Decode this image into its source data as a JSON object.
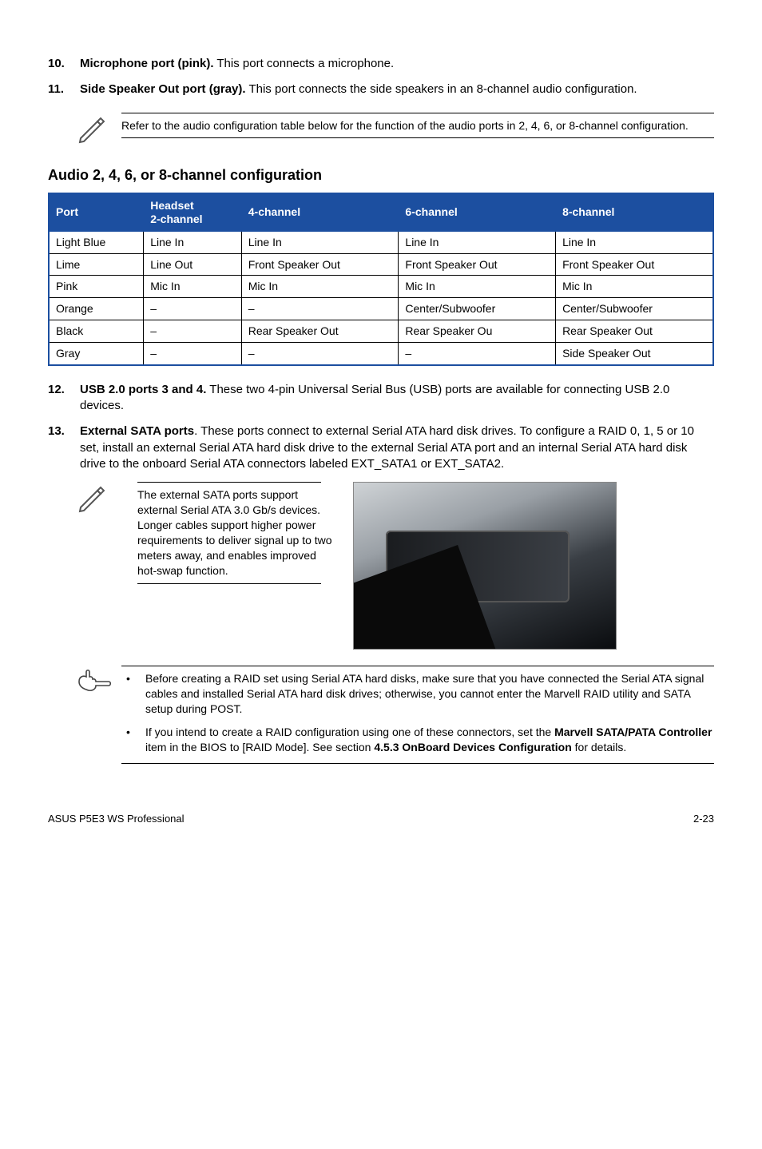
{
  "items": {
    "i10": {
      "num": "10.",
      "lead": "Microphone port (pink).",
      "rest": " This port connects a microphone."
    },
    "i11": {
      "num": "11.",
      "lead": "Side Speaker Out port (gray).",
      "rest": " This port connects the side speakers in an 8-channel audio configuration."
    },
    "i12": {
      "num": "12.",
      "lead": "USB 2.0 ports 3 and 4.",
      "rest": " These two 4-pin Universal Serial Bus (USB) ports are available for connecting USB 2.0 devices."
    },
    "i13": {
      "num": "13.",
      "lead": "External SATA ports",
      "rest": ". These ports connect to external Serial ATA hard disk drives. To configure a RAID 0, 1, 5 or 10 set, install an external Serial ATA hard disk drive to the external Serial ATA port and an internal Serial ATA hard disk drive to the onboard Serial ATA connectors labeled EXT_SATA1 or EXT_SATA2."
    }
  },
  "note1": "Refer to the audio configuration table below for the function of the audio ports in 2, 4, 6, or 8-channel configuration.",
  "section_heading": "Audio 2, 4, 6, or 8-channel configuration",
  "table": {
    "headers": {
      "c1": "Port",
      "c2_l1": "Headset",
      "c2_l2": "2-channel",
      "c3": "4-channel",
      "c4": "6-channel",
      "c5": "8-channel"
    },
    "rows": [
      {
        "c1": "Light Blue",
        "c2": "Line In",
        "c3": "Line In",
        "c4": "Line In",
        "c5": "Line In"
      },
      {
        "c1": "Lime",
        "c2": "Line Out",
        "c3": "Front Speaker Out",
        "c4": "Front Speaker Out",
        "c5": "Front Speaker Out"
      },
      {
        "c1": "Pink",
        "c2": "Mic In",
        "c3": "Mic In",
        "c4": "Mic In",
        "c5": "Mic In"
      },
      {
        "c1": "Orange",
        "c2": "–",
        "c3": "–",
        "c4": "Center/Subwoofer",
        "c5": "Center/Subwoofer"
      },
      {
        "c1": "Black",
        "c2": "–",
        "c3": "Rear Speaker Out",
        "c4": "Rear Speaker Ou",
        "c5": "Rear Speaker Out"
      },
      {
        "c1": "Gray",
        "c2": "–",
        "c3": "–",
        "c4": "–",
        "c5": "Side Speaker Out"
      }
    ]
  },
  "note2": "The external SATA ports support external Serial ATA 3.0 Gb/s devices. Longer cables support higher power requirements to deliver signal up to two meters away, and enables improved hot-swap function.",
  "bullets": {
    "b1": "Before creating a RAID set using Serial ATA hard disks, make sure that you have connected the Serial ATA signal cables and installed Serial ATA hard disk drives; otherwise, you cannot enter the Marvell RAID utility and SATA setup during POST.",
    "b2_pre": "If you intend to create a RAID configuration using one of these connectors, set the ",
    "b2_bold1": "Marvell SATA/PATA Controller",
    "b2_mid": " item in the BIOS to [RAID Mode]. See section ",
    "b2_bold2": "4.5.3 OnBoard Devices Configuration",
    "b2_post": " for details."
  },
  "footer": {
    "left": "ASUS P5E3 WS Professional",
    "right": "2-23"
  }
}
